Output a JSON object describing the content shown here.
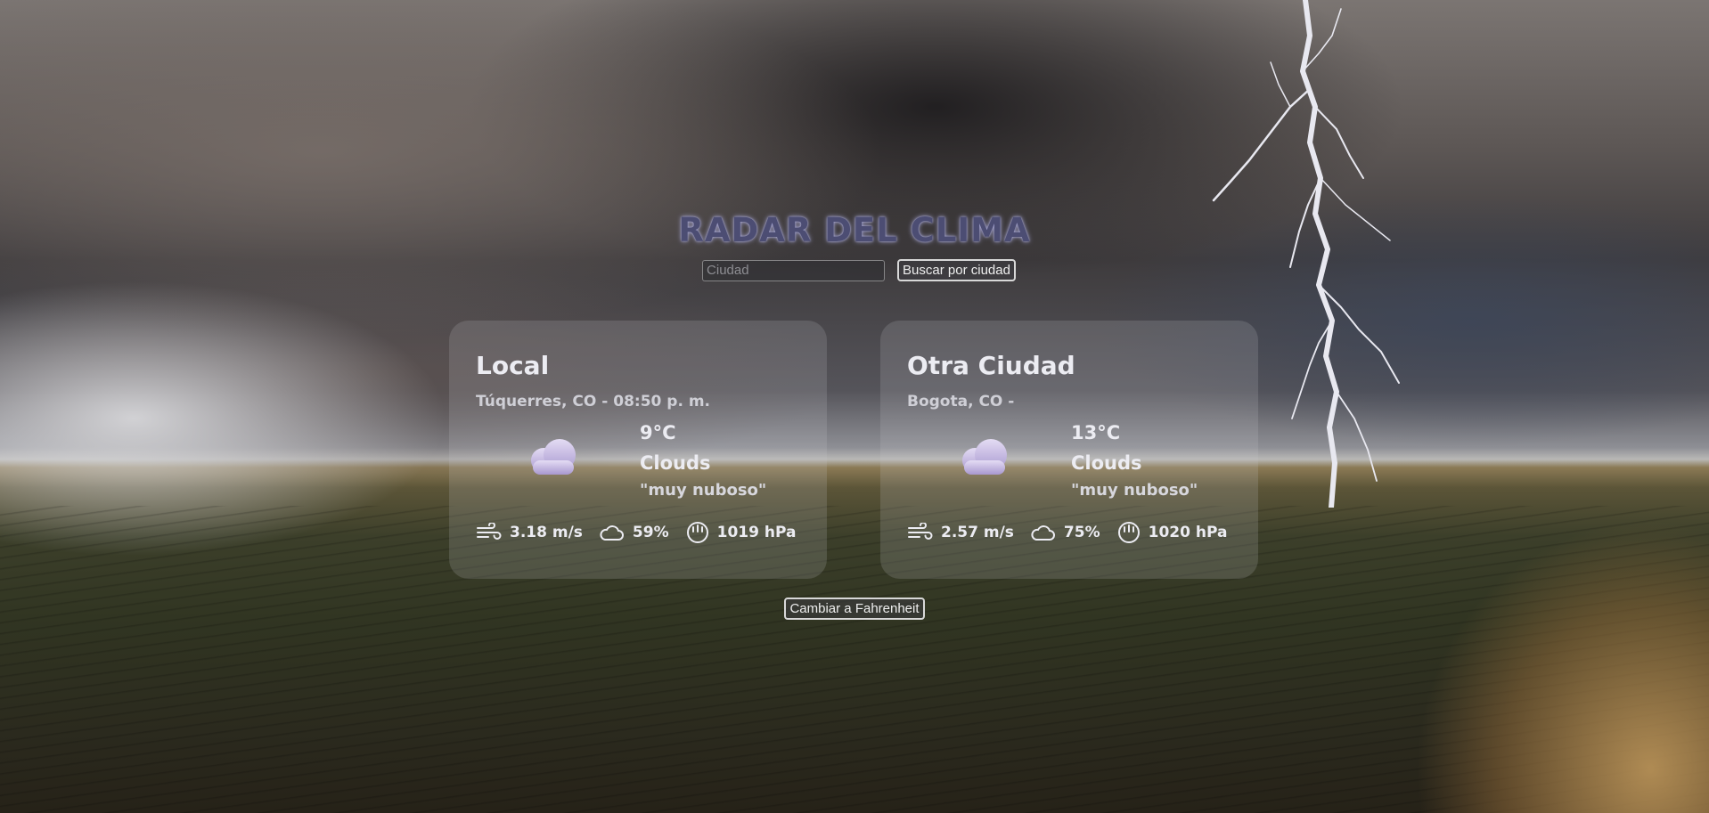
{
  "app": {
    "title": "RADAR DEL CLIMA"
  },
  "search": {
    "placeholder": "Ciudad",
    "value": "",
    "button_label": "Buscar por ciudad"
  },
  "cards": [
    {
      "title": "Local",
      "location": "Túquerres, CO - 08:50 p. m.",
      "temperature": "9°C",
      "condition": "Clouds",
      "description": "\"muy nuboso\"",
      "wind": "3.18 m/s",
      "humidity": "59%",
      "pressure": "1019 hPa",
      "icon": "clouds-icon"
    },
    {
      "title": "Otra Ciudad",
      "location": "Bogota, CO -",
      "temperature": "13°C",
      "condition": "Clouds",
      "description": "\"muy nuboso\"",
      "wind": "2.57 m/s",
      "humidity": "75%",
      "pressure": "1020 hPa",
      "icon": "clouds-icon"
    }
  ],
  "units": {
    "toggle_label": "Cambiar a Fahrenheit"
  },
  "colors": {
    "title": "#4c4d73",
    "card_bg": "rgba(200,200,205,0.18)",
    "cloud": "#b8a9d6"
  }
}
